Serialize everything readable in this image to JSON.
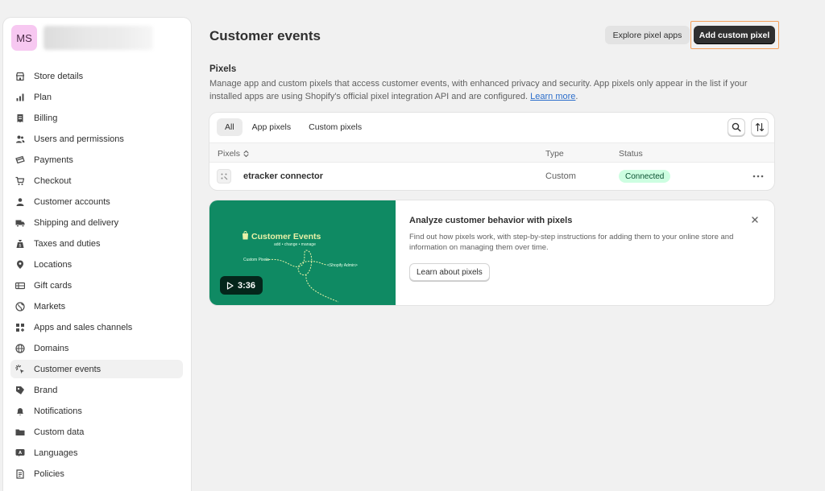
{
  "store": {
    "avatar_initials": "MS",
    "avatar_color": "#f7c8f1"
  },
  "sidebar": {
    "items": [
      {
        "label": "Store details",
        "icon": "store-icon"
      },
      {
        "label": "Plan",
        "icon": "chart-icon"
      },
      {
        "label": "Billing",
        "icon": "receipt-icon"
      },
      {
        "label": "Users and permissions",
        "icon": "users-icon"
      },
      {
        "label": "Payments",
        "icon": "payments-icon"
      },
      {
        "label": "Checkout",
        "icon": "cart-icon"
      },
      {
        "label": "Customer accounts",
        "icon": "person-icon"
      },
      {
        "label": "Shipping and delivery",
        "icon": "truck-icon"
      },
      {
        "label": "Taxes and duties",
        "icon": "tax-bag-icon"
      },
      {
        "label": "Locations",
        "icon": "location-pin-icon"
      },
      {
        "label": "Gift cards",
        "icon": "gift-card-icon"
      },
      {
        "label": "Markets",
        "icon": "globe-icon"
      },
      {
        "label": "Apps and sales channels",
        "icon": "apps-icon"
      },
      {
        "label": "Domains",
        "icon": "domain-globe-icon"
      },
      {
        "label": "Customer events",
        "icon": "cursor-sparkle-icon",
        "active": true
      },
      {
        "label": "Brand",
        "icon": "brand-icon"
      },
      {
        "label": "Notifications",
        "icon": "bell-icon"
      },
      {
        "label": "Custom data",
        "icon": "folder-icon"
      },
      {
        "label": "Languages",
        "icon": "language-icon"
      },
      {
        "label": "Policies",
        "icon": "policy-icon"
      }
    ]
  },
  "header": {
    "title": "Customer events",
    "explore_label": "Explore pixel apps",
    "add_label": "Add custom pixel",
    "highlight_color": "#f5a05a"
  },
  "pixels": {
    "title": "Pixels",
    "description": "Manage app and custom pixels that access customer events, with enhanced privacy and security. App pixels only appear in the list if your installed apps are using Shopify's official pixel integration API and are configured.",
    "learn_more": "Learn more",
    "tabs": [
      {
        "label": "All",
        "active": true
      },
      {
        "label": "App pixels"
      },
      {
        "label": "Custom pixels"
      }
    ],
    "columns": {
      "pixels": "Pixels",
      "type": "Type",
      "status": "Status"
    },
    "rows": [
      {
        "name": "etracker connector",
        "type": "Custom",
        "status": "Connected",
        "status_color": "#cdfee1"
      }
    ]
  },
  "promo": {
    "video_title": "Customer Events",
    "video_subtitle": "add • change • manage",
    "video_label_left": "Custom Pixels",
    "video_label_right": "<Shopify Admin>",
    "duration": "3:36",
    "title": "Analyze customer behavior with pixels",
    "description": "Find out how pixels work, with step-by-step instructions for adding them to your online store and information on managing them over time.",
    "button_label": "Learn about pixels",
    "video_color": "#0f8a63"
  }
}
